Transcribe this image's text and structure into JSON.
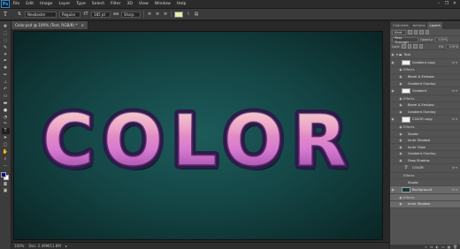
{
  "app": {
    "logo": "Ps"
  },
  "menu": [
    "File",
    "Edit",
    "Image",
    "Layer",
    "Type",
    "Select",
    "Filter",
    "3D",
    "View",
    "Window",
    "Help"
  ],
  "window_controls": [
    "–",
    "❐",
    "✕"
  ],
  "options": {
    "tool_glyph": "T",
    "font_family": "Nexbaster",
    "font_style": "Regular",
    "size_icon": "tT",
    "font_size": "185 pt",
    "aa_icon": "aa",
    "antialias": "Sharp",
    "text_color": "#e8ecb0"
  },
  "document": {
    "tab_title": "Color.psd @ 100% (Text, RGB/8) *",
    "close_glyph": "×",
    "canvas_text": "COLOR",
    "canvas_colors": {
      "bg_center": "#1d5b5b",
      "bg_edge": "#0a2525",
      "text_top": "#f3b3a1",
      "text_mid": "#d77bd0",
      "text_bottom": "#8a3a9a",
      "outline": "#2a1c47"
    }
  },
  "status": {
    "zoom": "100%",
    "doc_info": "Doc: 2.49M/11.8M"
  },
  "panel": {
    "tabs": [
      "Channels",
      "Actions",
      "Layers"
    ],
    "active_tab": "Layers",
    "filter": "Kind",
    "blend_mode": "Pass Through",
    "opacity_label": "Opacity:",
    "opacity": "100%",
    "lock_label": "Lock:",
    "fill_label": "Fill:",
    "fill": "100%"
  },
  "layers": [
    {
      "type": "group",
      "name": "Text"
    },
    {
      "type": "layer",
      "name": "Gradient copy",
      "fx": true
    },
    {
      "type": "caption",
      "name": "Effects"
    },
    {
      "type": "effect",
      "name": "Bevel & Emboss"
    },
    {
      "type": "effect",
      "name": "Gradient Overlay"
    },
    {
      "type": "layer",
      "name": "Gradient",
      "fx": true
    },
    {
      "type": "caption",
      "name": "Effects"
    },
    {
      "type": "effect",
      "name": "Bevel & Emboss"
    },
    {
      "type": "effect",
      "name": "Gradient Overlay"
    },
    {
      "type": "layer",
      "name": "COLOR copy",
      "fx": true
    },
    {
      "type": "caption",
      "name": "Effects"
    },
    {
      "type": "effect",
      "name": "Stroke"
    },
    {
      "type": "effect",
      "name": "Inner Shadow"
    },
    {
      "type": "effect",
      "name": "Inner Glow"
    },
    {
      "type": "effect",
      "name": "Gradient Overlay"
    },
    {
      "type": "effect",
      "name": "Drop Shadow"
    },
    {
      "type": "text",
      "name": "COLOR",
      "fx": true
    },
    {
      "type": "caption",
      "name": "Effects"
    },
    {
      "type": "effect",
      "name": "Stroke"
    },
    {
      "type": "background",
      "name": "Background",
      "fx": true
    },
    {
      "type": "caption",
      "name": "Effects"
    },
    {
      "type": "effect",
      "name": "Inner Shadow"
    }
  ],
  "panel_footer": [
    "∞",
    "fx",
    "◐",
    "▭",
    "▦",
    "🗑"
  ]
}
